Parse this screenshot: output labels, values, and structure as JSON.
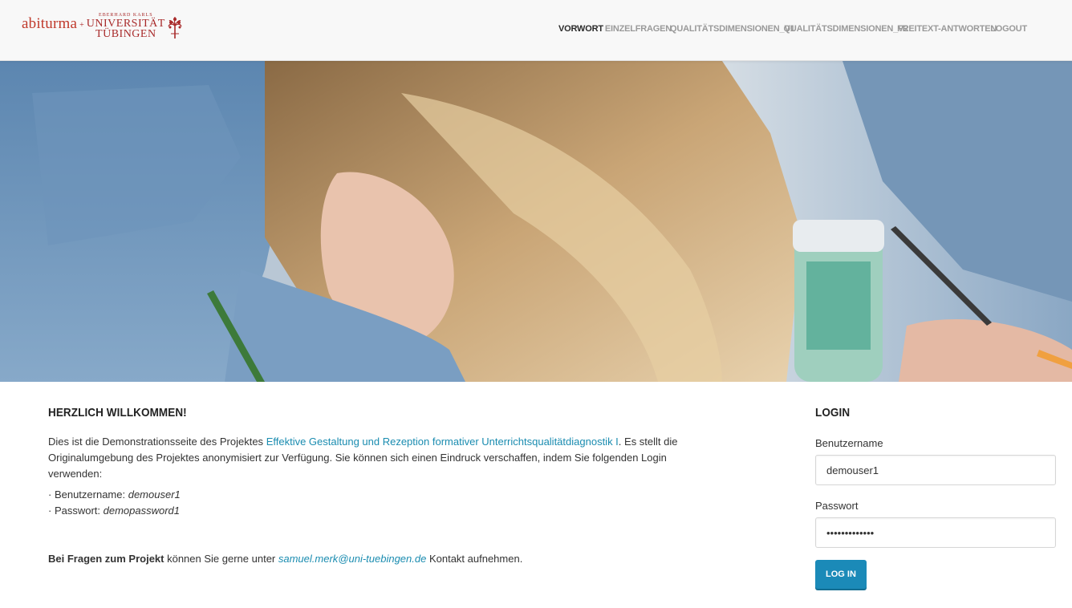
{
  "header": {
    "logo": {
      "abiturma": "abiturma",
      "plus": "+",
      "uni_small": "EBERHARD KARLS",
      "uni_line1": "UNIVERSITÄT",
      "uni_line2": "TÜBINGEN"
    },
    "nav": [
      {
        "label": "VORWORT",
        "active": true
      },
      {
        "label": "EINZELFRAGEN",
        "active": false
      },
      {
        "label": "QUALITÄTSDIMENSIONEN_V1",
        "active": false
      },
      {
        "label": "QUALITÄTSDIMENSIONEN_V2",
        "active": false
      },
      {
        "label": "FREITEXT-ANTWORTEN",
        "active": false
      },
      {
        "label": "LOGOUT",
        "active": false
      }
    ]
  },
  "hero": {
    "description_icon": "student-writing-photo"
  },
  "welcome": {
    "title": "HERZLICH WILLKOMMEN!",
    "intro_before": "Dies ist die Demonstrationsseite des Projektes ",
    "project_link": "Effektive Gestaltung und Rezeption formativer Unterrichtsqualitätdiagnostik I",
    "intro_after": ". Es stellt die Originalumgebung des Projektes anonymisiert zur Verfügung. Sie können sich einen Eindruck verschaffen, indem Sie folgenden Login verwenden:",
    "cred_user_label": "· Benutzername: ",
    "cred_user_value": "demouser1",
    "cred_pass_label": "· Passwort: ",
    "cred_pass_value": "demopassword1",
    "contact_bold": "Bei Fragen zum Projekt",
    "contact_mid": " können Sie gerne unter ",
    "contact_email": "samuel.merk@uni-tuebingen.de",
    "contact_end": " Kontakt aufnehmen."
  },
  "login": {
    "title": "LOGIN",
    "username_label": "Benutzername",
    "username_value": "demouser1",
    "password_label": "Passwort",
    "password_value": "•••••••••••••",
    "button_label": "LOG IN"
  },
  "colors": {
    "accent": "#1b8ab8",
    "link": "#1a8cb0",
    "logo_red": "#a82a2a"
  }
}
